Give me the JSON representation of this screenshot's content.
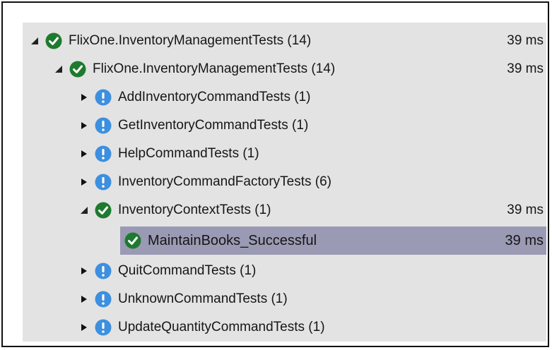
{
  "test_tree": {
    "root": {
      "label": "FlixOne.InventoryManagementTests (14)",
      "duration": "39 ms",
      "status": "passed",
      "expander": "expanded"
    },
    "project": {
      "label": "FlixOne.InventoryManagementTests (14)",
      "duration": "39 ms",
      "status": "passed",
      "expander": "expanded"
    },
    "classes": [
      {
        "label": "AddInventoryCommandTests (1)",
        "status": "not-run",
        "expander": "collapsed"
      },
      {
        "label": "GetInventoryCommandTests (1)",
        "status": "not-run",
        "expander": "collapsed"
      },
      {
        "label": "HelpCommandTests (1)",
        "status": "not-run",
        "expander": "collapsed"
      },
      {
        "label": "InventoryCommandFactoryTests (6)",
        "status": "not-run",
        "expander": "collapsed"
      },
      {
        "label": "InventoryContextTests (1)",
        "duration": "39 ms",
        "status": "passed",
        "expander": "expanded"
      },
      {
        "label": "MaintainBooks_Successful",
        "duration": "39 ms",
        "status": "passed",
        "selected": true
      },
      {
        "label": "QuitCommandTests (1)",
        "status": "not-run",
        "expander": "collapsed"
      },
      {
        "label": "UnknownCommandTests (1)",
        "status": "not-run",
        "expander": "collapsed"
      },
      {
        "label": "UpdateQuantityCommandTests (1)",
        "status": "not-run",
        "expander": "collapsed"
      }
    ],
    "icons": {
      "passed": "check-circle-icon",
      "not_run": "info-circle-icon",
      "expanded": "triangle-expanded-icon",
      "collapsed": "triangle-collapsed-icon"
    },
    "colors": {
      "passed": "#1e7a2e",
      "not_run": "#3d8fe0",
      "panel": "#e3e3e3",
      "selected": "#9a9ab4"
    }
  }
}
